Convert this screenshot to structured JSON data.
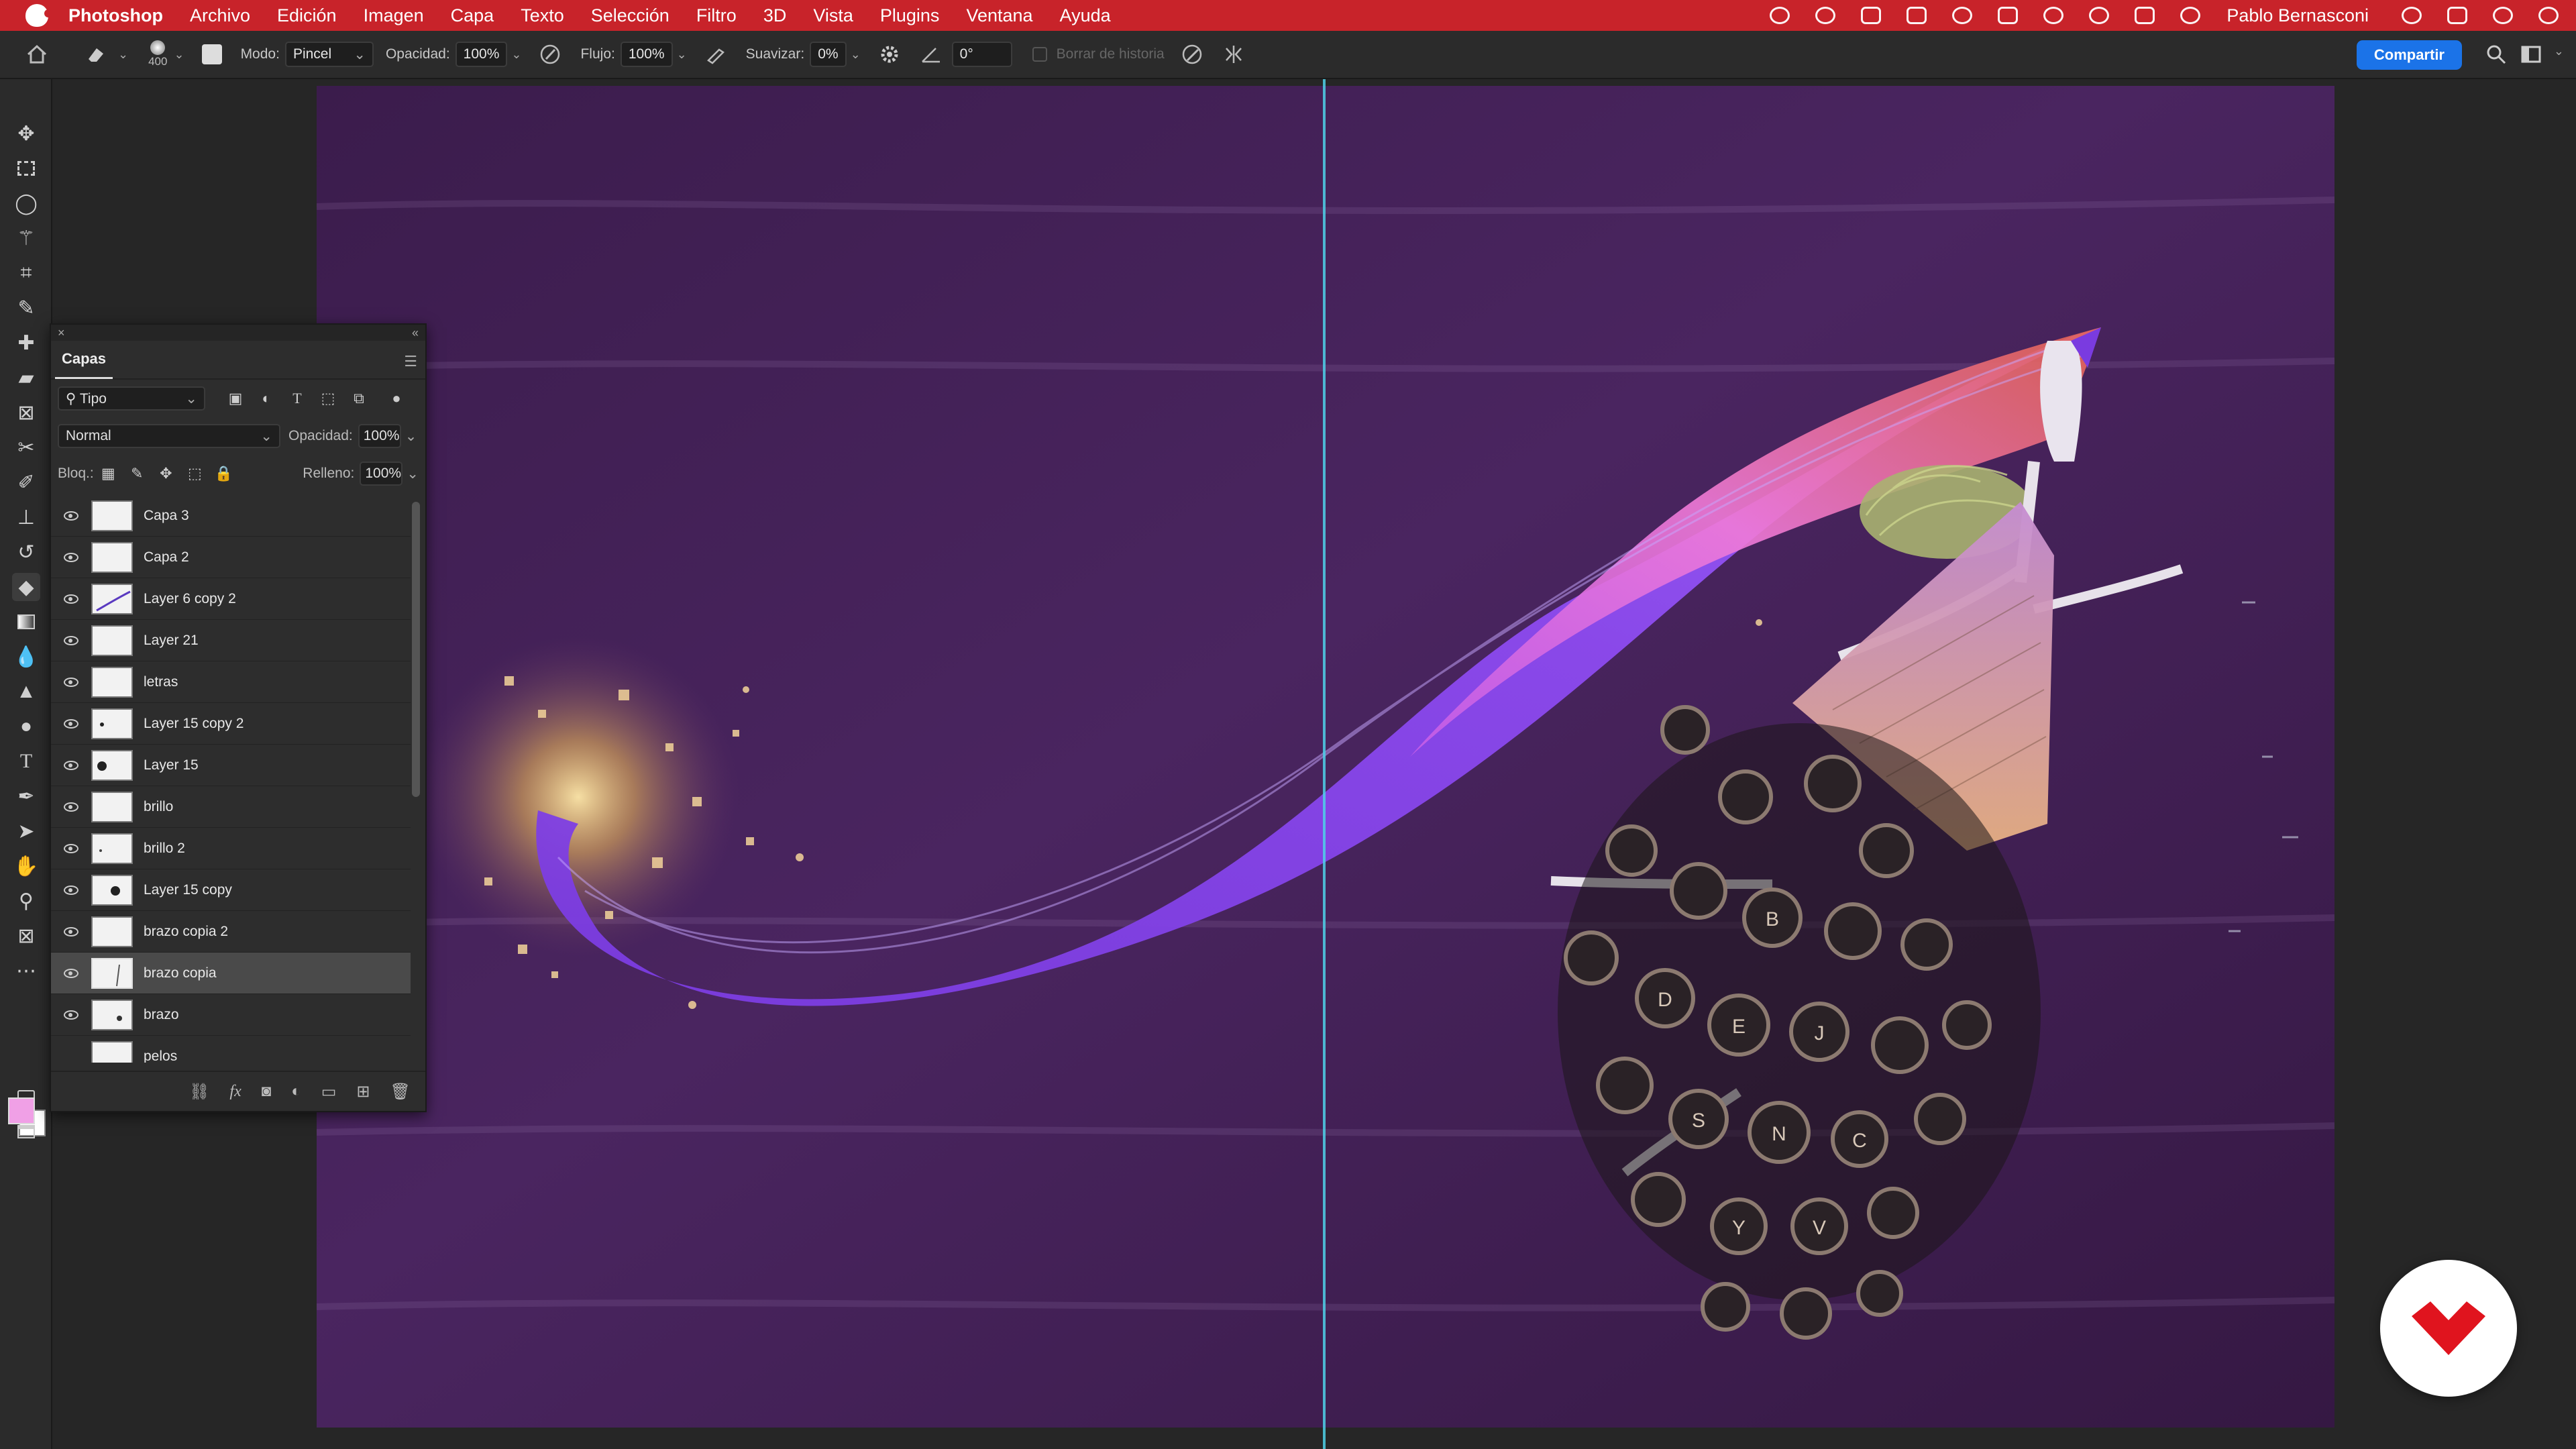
{
  "menubar": {
    "app": "Photoshop",
    "items": [
      "Archivo",
      "Edición",
      "Imagen",
      "Capa",
      "Texto",
      "Selección",
      "Filtro",
      "3D",
      "Vista",
      "Plugins",
      "Ventana",
      "Ayuda"
    ],
    "user": "Pablo Bernasconi"
  },
  "options": {
    "brush_size": "400",
    "mode_label": "Modo:",
    "mode_value": "Pincel",
    "opacity_label": "Opacidad:",
    "opacity_value": "100%",
    "flow_label": "Flujo:",
    "flow_value": "100%",
    "smooth_label": "Suavizar:",
    "smooth_value": "0%",
    "angle_value": "0°",
    "history_label": "Borrar de historia",
    "share_label": "Compartir"
  },
  "layers_panel": {
    "tab": "Capas",
    "filter_value": "Tipo",
    "blend_value": "Normal",
    "opacity_label": "Opacidad:",
    "opacity_value": "100%",
    "lock_label": "Bloq.:",
    "fill_label": "Relleno:",
    "fill_value": "100%",
    "layers": [
      {
        "name": "Capa 3"
      },
      {
        "name": "Capa 2"
      },
      {
        "name": "Layer 6 copy 2"
      },
      {
        "name": "Layer 21"
      },
      {
        "name": "letras"
      },
      {
        "name": "Layer 15 copy 2"
      },
      {
        "name": "Layer 15"
      },
      {
        "name": "brillo"
      },
      {
        "name": "brillo 2"
      },
      {
        "name": "Layer 15 copy"
      },
      {
        "name": "brazo copia 2"
      },
      {
        "name": "brazo copia"
      },
      {
        "name": "brazo"
      },
      {
        "name": "pelos"
      }
    ],
    "selected_layer": "brazo copia",
    "bottom_fx": "fx"
  },
  "colors": {
    "menubar": "#c8232a",
    "share": "#1b73e8",
    "foreground": "#f0a0e6",
    "background": "#ffffff",
    "guide": "#4fd0e8"
  }
}
